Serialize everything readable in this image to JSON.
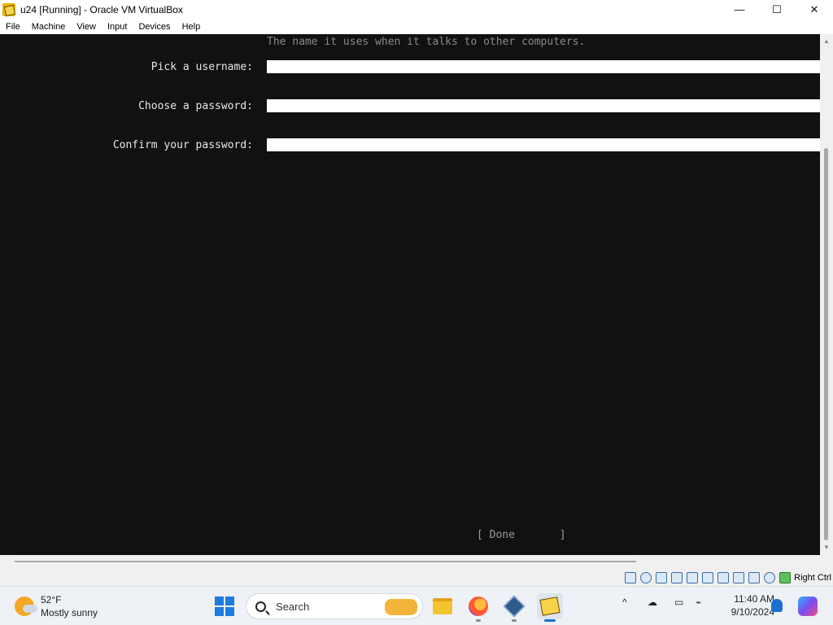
{
  "window": {
    "title": "u24 [Running] - Oracle VM VirtualBox",
    "controls": {
      "minimize": "—",
      "maximize": "☐",
      "close": "✕"
    }
  },
  "menu": [
    "File",
    "Machine",
    "View",
    "Input",
    "Devices",
    "Help"
  ],
  "vm": {
    "hint": "The name it uses when it talks to other computers.",
    "fields": [
      {
        "label": "Pick a username:",
        "value": ""
      },
      {
        "label": "Choose a password:",
        "value": ""
      },
      {
        "label": "Confirm your password:",
        "value": ""
      }
    ],
    "done_button": "[ Done       ]"
  },
  "statusbar": {
    "host_key": "Right Ctrl",
    "icons": [
      "hard-disk-icon",
      "optical-drive-icon",
      "audio-icon",
      "network-icon",
      "usb-icon",
      "shared-folders-icon",
      "display-icon",
      "recording-icon",
      "cpu-icon",
      "mouse-integration-icon",
      "keyboard-icon"
    ]
  },
  "taskbar": {
    "weather": {
      "temp": "52°F",
      "desc": "Mostly sunny"
    },
    "search_placeholder": "Search",
    "apps": [
      "file-explorer",
      "firefox",
      "virtualbox-manager",
      "virtualbox-vm"
    ],
    "clock": {
      "time": "11:40 AM",
      "date": "9/10/2024"
    },
    "tray_chevron": "^"
  }
}
